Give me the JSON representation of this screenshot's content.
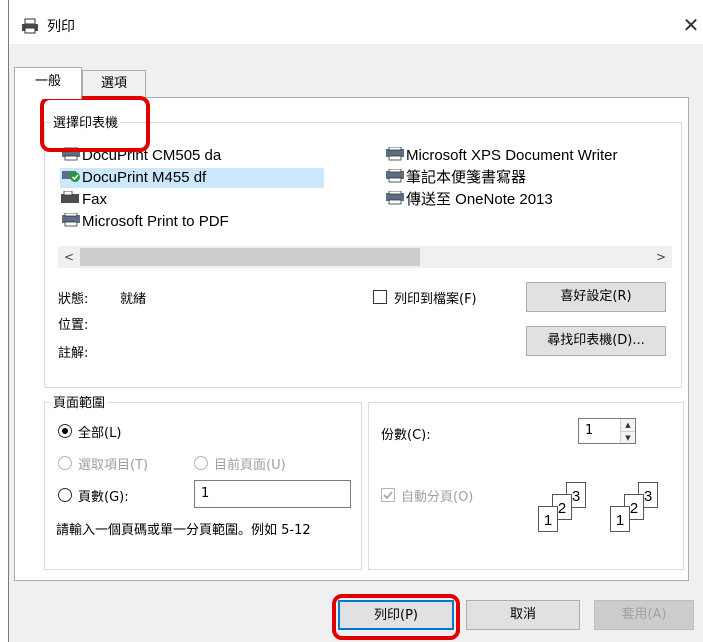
{
  "window": {
    "title": "列印",
    "close_symbol": "✕"
  },
  "tabs": [
    {
      "label": "一般",
      "active": true
    },
    {
      "label": "選項",
      "active": false
    }
  ],
  "select_printer": {
    "label": "選擇印表機",
    "printers": [
      {
        "name": "DocuPrint CM505 da",
        "icon": "printer-icon",
        "selected": false
      },
      {
        "name": "DocuPrint M455 df",
        "icon": "default-printer-icon",
        "selected": true
      },
      {
        "name": "Fax",
        "icon": "fax-icon",
        "selected": false
      },
      {
        "name": "Microsoft Print to PDF",
        "icon": "printer-icon",
        "selected": false
      },
      {
        "name": "Microsoft XPS Document Writer",
        "icon": "printer-icon",
        "selected": false
      },
      {
        "name": "筆記本便箋書寫器",
        "icon": "printer-icon",
        "selected": false
      },
      {
        "name": "傳送至 OneNote 2013",
        "icon": "printer-icon",
        "selected": false
      }
    ],
    "scroll_left": "<",
    "scroll_right": ">"
  },
  "status": {
    "status_label": "狀態:",
    "status_value": "就緒",
    "location_label": "位置:",
    "comment_label": "註解:"
  },
  "print_to_file": {
    "label": "列印到檔案(F)",
    "checked": false
  },
  "buttons": {
    "preferences": "喜好設定(R)",
    "find_printer": "尋找印表機(D)...",
    "print": "列印(P)",
    "cancel": "取消",
    "apply": "套用(A)"
  },
  "page_range": {
    "label": "頁面範圍",
    "all": "全部(L)",
    "selection": "選取項目(T)",
    "current_page": "目前頁面(U)",
    "pages": "頁數(G):",
    "pages_value": "1",
    "hint": "請輸入一個頁碼或單一分頁範圍。例如 5-12",
    "selected_option": "all"
  },
  "copies": {
    "label": "份數(C):",
    "value": "1",
    "spin_up": "▲",
    "spin_down": "▼",
    "collate_label": "自動分頁(O)",
    "collate_checked": true,
    "collate_pages": [
      "1",
      "2",
      "3"
    ]
  },
  "colors": {
    "highlight_red": "#e00000",
    "selection_blue": "#cce8ff",
    "dialog_bg": "#f0f0f0"
  }
}
